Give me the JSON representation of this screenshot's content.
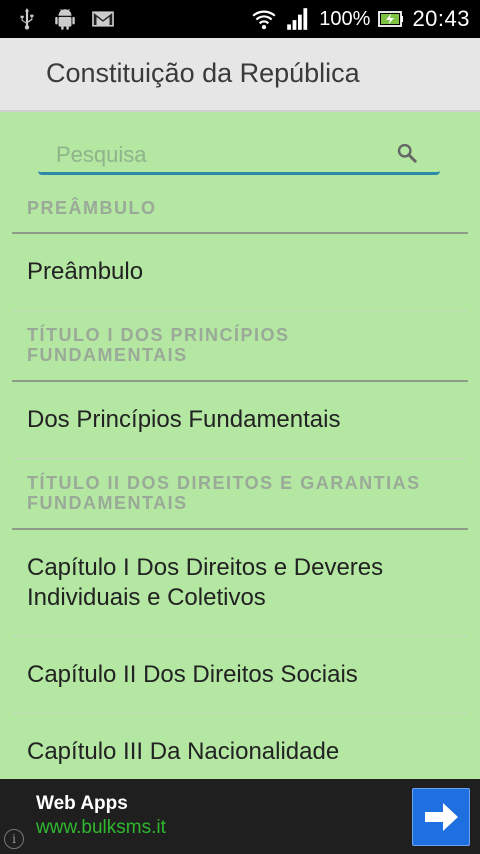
{
  "status_bar": {
    "battery": "100%",
    "time": "20:43",
    "icons": [
      "usb-icon",
      "android-debug-icon",
      "gmail-icon",
      "wifi-icon",
      "signal-icon",
      "battery-charging-icon"
    ]
  },
  "app": {
    "title": "Constituição da República"
  },
  "search": {
    "placeholder": "Pesquisa",
    "value": "",
    "icon": "search-icon"
  },
  "list": {
    "preambulo_header": "PREÂMBULO",
    "preambulo_item": "Preâmbulo",
    "titulo1_header": "TÍTULO I DOS PRINCÍPIOS FUNDAMENTAIS",
    "titulo1_item": "Dos Princípios Fundamentais",
    "titulo2_header": "TÍTULO II DOS DIREITOS E GARANTIAS FUNDAMENTAIS",
    "titulo2_items": [
      "Capítulo I Dos Direitos e Deveres Individuais e Coletivos",
      "Capítulo II Dos Direitos Sociais",
      "Capítulo III Da Nacionalidade"
    ]
  },
  "ad": {
    "title": "Web Apps",
    "url": "www.bulksms.it",
    "info_glyph": "i",
    "colors": {
      "background": "#1f1f1f",
      "url": "#2eb82e",
      "button": "#1e6fe0"
    }
  },
  "colors": {
    "background": "#b3e7a2",
    "titlebar": "#e6e6e6",
    "section_text": "#9aa998",
    "search_underline": "#2c8aa8"
  }
}
